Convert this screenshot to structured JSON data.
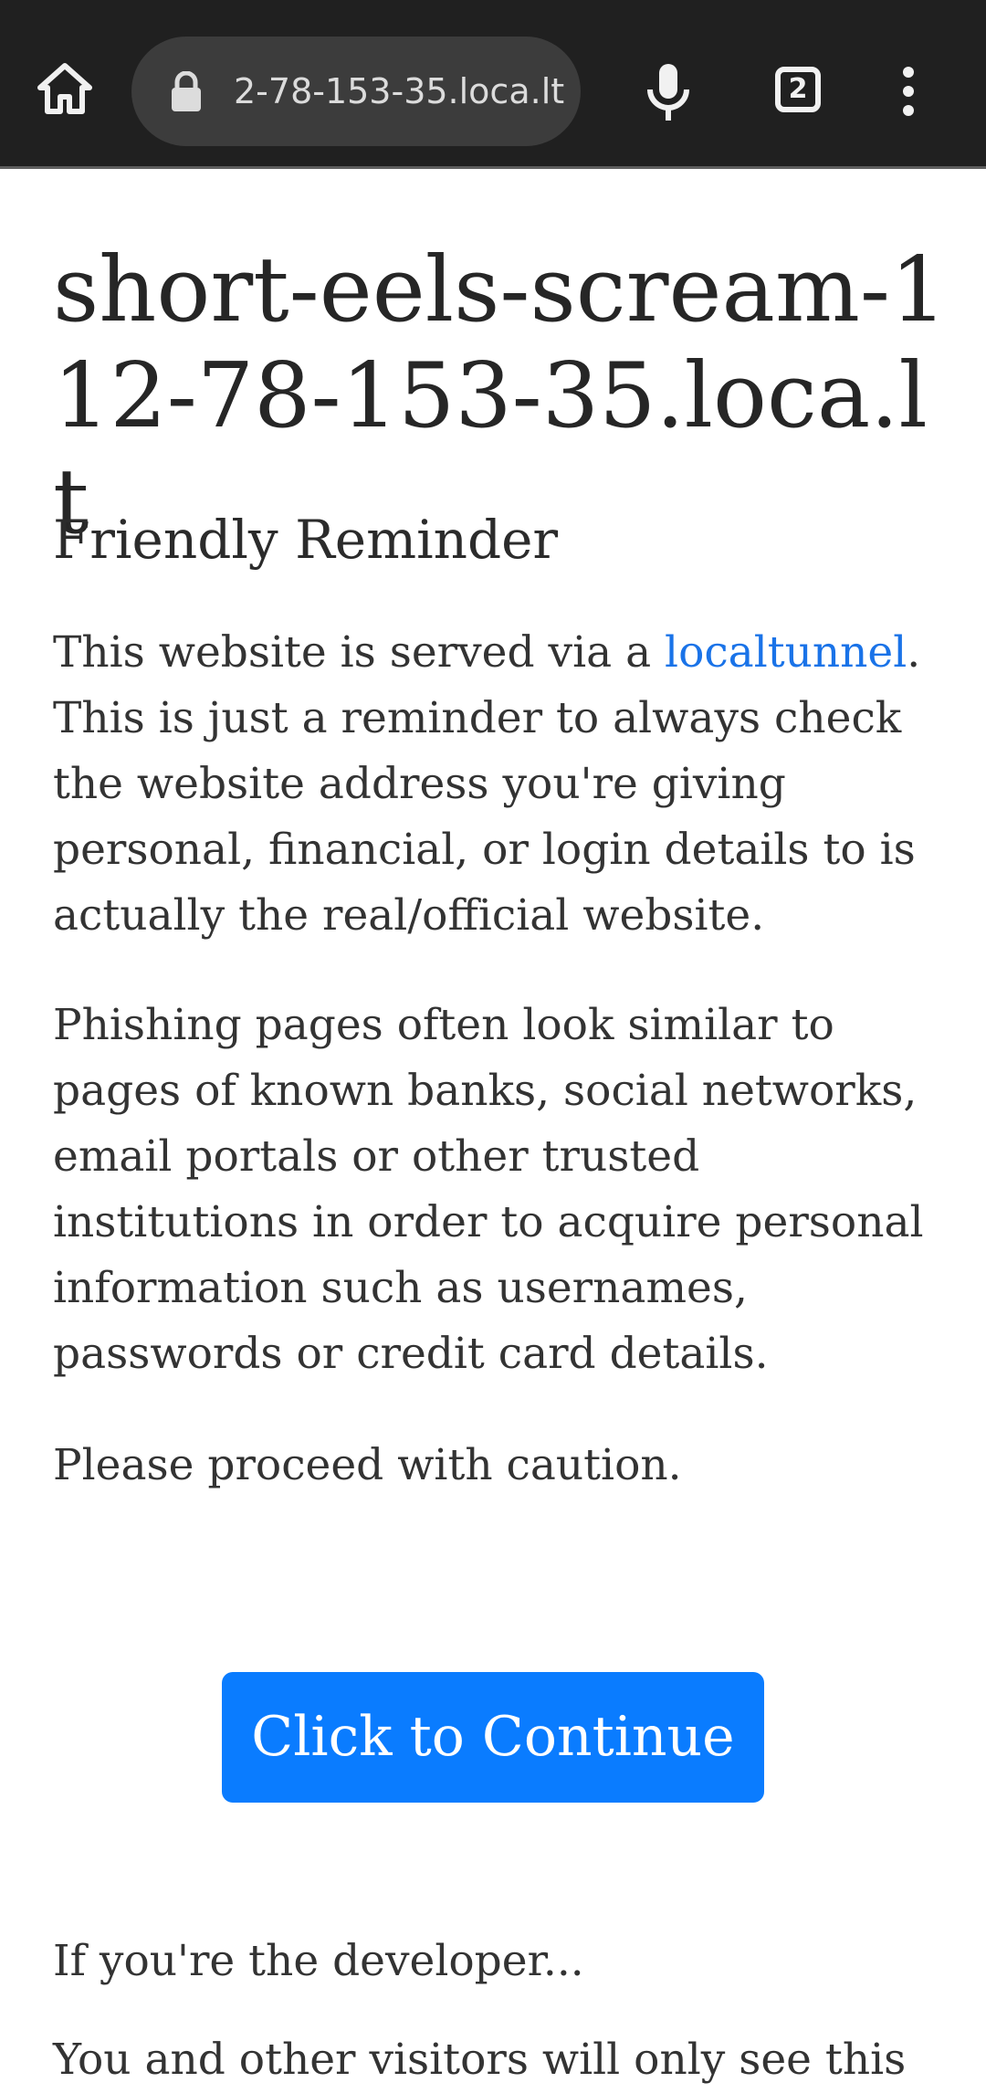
{
  "browser": {
    "url": "2-78-153-35.loca.lt",
    "tab_count": "2",
    "icons": [
      "home-icon",
      "lock-icon",
      "microphone-icon",
      "tabs-icon",
      "more-vert-icon"
    ],
    "colors": {
      "toolbar": "#202020",
      "omnibox": "#3c3c3c"
    }
  },
  "page": {
    "host_title": "short-eels-scream-112-78-153-35.loca.lt",
    "heading": "Friendly Reminder",
    "p1_prefix": "This website is served via a ",
    "p1_link": "localtunnel",
    "p1_suffix": ". This is just a reminder to always check the website address you're giving personal, financial, or login details to is actually the real/official website.",
    "p2": "Phishing pages often look similar to pages of known banks, social networks, email portals or other trusted institutions in order to acquire personal information such as usernames, passwords or credit card details.",
    "p3": "Please proceed with caution.",
    "continue_label": "Click to Continue",
    "developer_heading": "If you're the developer...",
    "developer_text": "You and other visitors will only see this",
    "colors": {
      "link": "#1a73e8",
      "button": "#0a7cff"
    }
  }
}
